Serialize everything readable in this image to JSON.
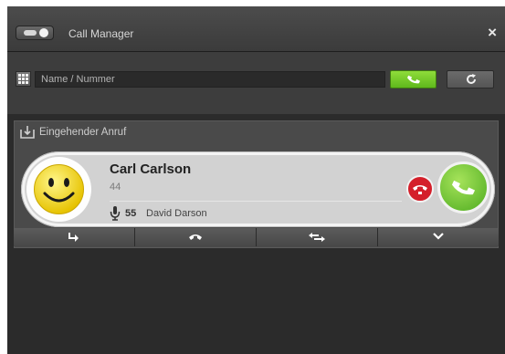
{
  "window": {
    "title": "Call Manager",
    "close_label": "×"
  },
  "search": {
    "placeholder": "Name / Nummer",
    "value": ""
  },
  "incoming": {
    "section_label": "Eingehender Anruf",
    "caller_name": "Carl Carlson",
    "caller_number": "44",
    "line_number": "55",
    "line_name": "David Darson"
  },
  "icons": {
    "toggle": "toggle-switch-icon",
    "dialpad": "dialpad-icon",
    "call": "phone-call-icon",
    "refresh": "refresh-icon",
    "incoming": "incoming-call-tray-icon",
    "avatar": "smiley-avatar-icon",
    "microphone": "microphone-icon",
    "reject": "hangup-icon",
    "accept": "accept-call-icon",
    "forward": "forward-arrow-icon",
    "hangup_action": "hangup-action-icon",
    "transfer": "transfer-arrows-icon",
    "more": "chevron-down-icon"
  },
  "colors": {
    "accent_green": "#6cc625",
    "reject_red": "#d41f2a",
    "background": "#2b2b2b"
  }
}
